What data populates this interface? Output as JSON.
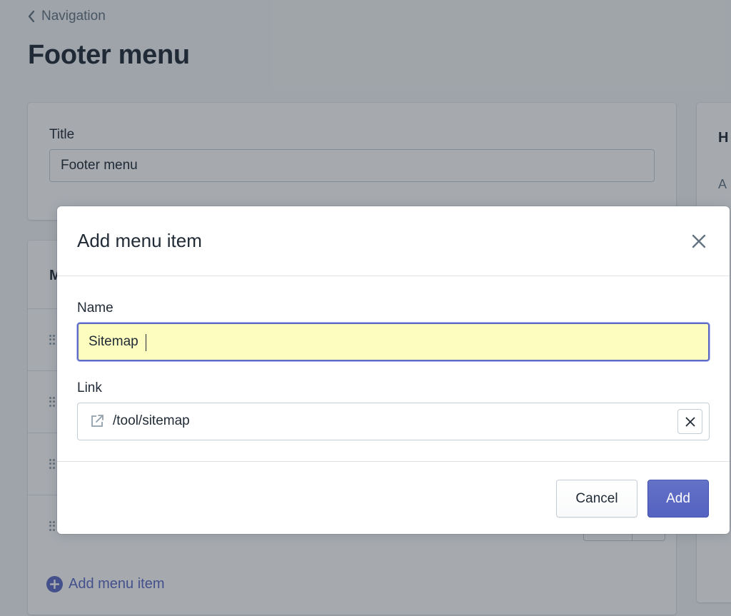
{
  "page": {
    "breadcrumb_label": "Navigation",
    "title": "Footer menu",
    "title_card": {
      "label": "Title",
      "value": "Footer menu"
    },
    "side_card": {
      "heading_fragment": "H",
      "text_fragment": "A"
    },
    "menu_card": {
      "heading_fragment": "M",
      "rows": [
        {},
        {},
        {},
        {}
      ],
      "add_item_label": "Add menu item"
    }
  },
  "modal": {
    "title": "Add menu item",
    "name_label": "Name",
    "name_value": "Sitemap",
    "link_label": "Link",
    "link_value": "/tool/sitemap",
    "cancel_label": "Cancel",
    "add_label": "Add"
  },
  "colors": {
    "accent": "#5c6ac4",
    "focused_input_bg": "#fdfdbf",
    "text": "#212b36",
    "subdued_text": "#637381"
  },
  "icons": {
    "breadcrumb": "chevron-left-icon",
    "drag": "drag-handle-icon",
    "add": "plus-circle-icon",
    "close": "close-icon",
    "external": "external-link-icon",
    "clear": "clear-icon"
  }
}
